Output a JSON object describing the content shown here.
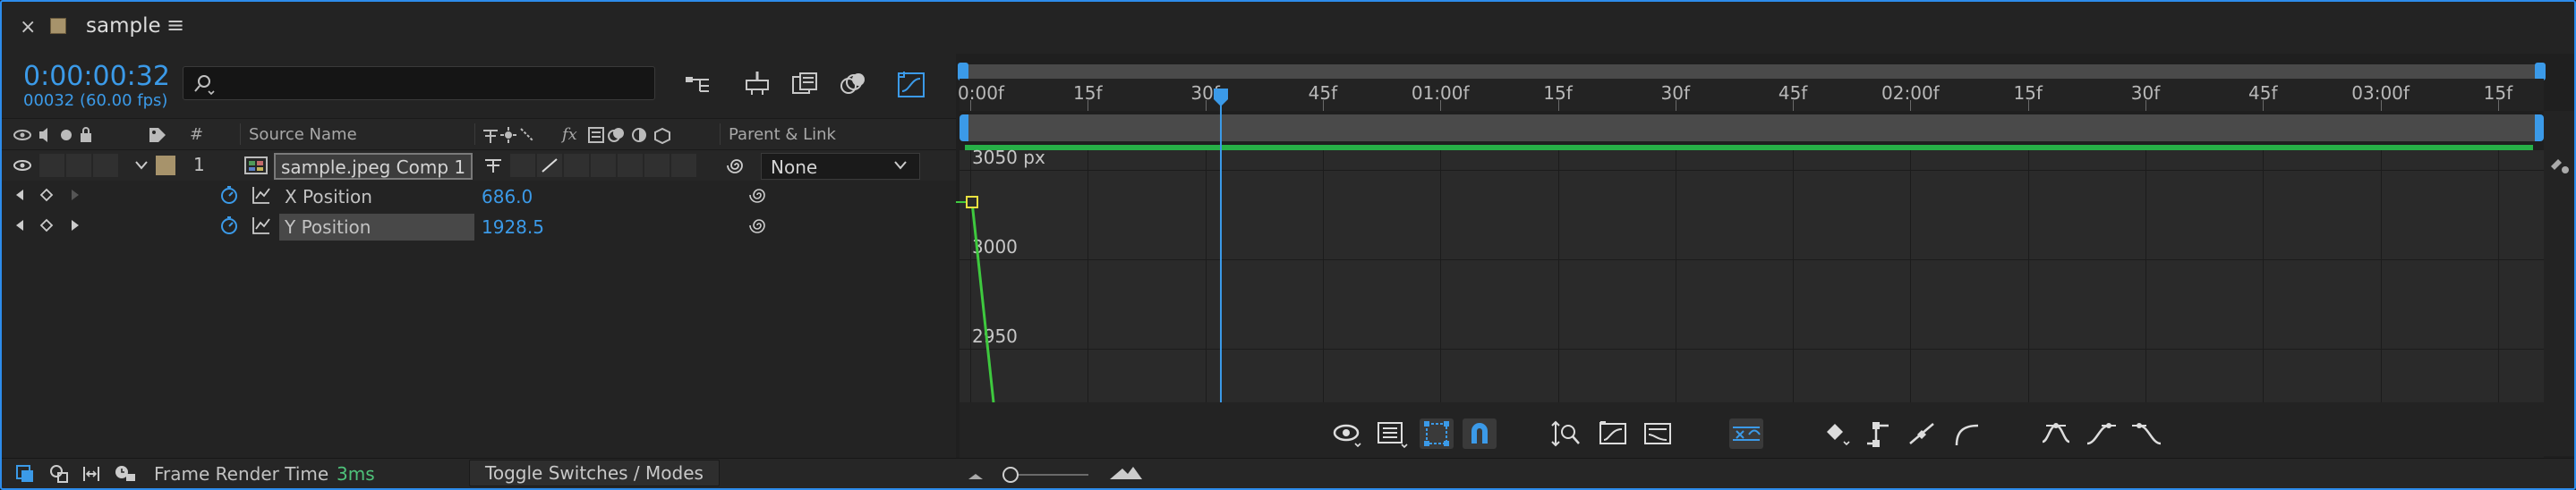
{
  "panel": {
    "close_glyph": "×",
    "title": "sample",
    "menu_glyph": "≡",
    "swatch_color": "#a7936b"
  },
  "time": {
    "timecode": "0:00:00:32",
    "frames": "00032 (60.00 fps)"
  },
  "search": {
    "placeholder": "",
    "icon": "search-icon"
  },
  "header": {
    "number": "#",
    "source_name": "Source Name",
    "parent_link": "Parent & Link",
    "fx": "fx"
  },
  "layers": [
    {
      "number": "1",
      "name": "sample.jpeg Comp 1",
      "parent": "None"
    }
  ],
  "properties": [
    {
      "name": "X Position",
      "value": "686.0"
    },
    {
      "name": "Y Position",
      "value": "1928.5"
    }
  ],
  "footer": {
    "render_label": "Frame Render Time",
    "render_value": "3ms",
    "toggle_label": "Toggle Switches / Modes"
  },
  "ruler": {
    "ticks": [
      "0:00f",
      "15f",
      "30f",
      "45f",
      "01:00f",
      "15f",
      "30f",
      "45f",
      "02:00f",
      "15f",
      "30f",
      "45f",
      "03:00f",
      "15f"
    ]
  },
  "graph": {
    "value_labels": [
      "3050 px",
      "3000",
      "2950"
    ]
  },
  "colors": {
    "accent": "#3b9ae8",
    "green": "#27b047",
    "curve": "#3ec93e"
  }
}
